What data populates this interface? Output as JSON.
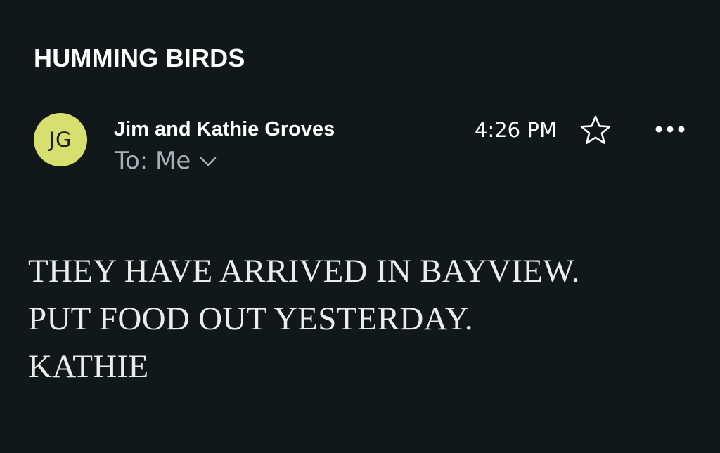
{
  "email": {
    "subject": "HUMMING BIRDS",
    "sender": {
      "initials": "JG",
      "name": "Jim and Kathie Groves",
      "avatar_color": "#d7e06f"
    },
    "recipient_label": "To: Me",
    "time": "4:26 PM",
    "body_lines": [
      "THEY HAVE ARRIVED IN BAYVIEW.",
      "PUT FOOD OUT YESTERDAY.",
      "KATHIE"
    ]
  },
  "icons": {
    "expand": "chevron-down-icon",
    "star": "star-icon",
    "more": "more-horizontal-icon"
  },
  "colors": {
    "background": "#121719",
    "text": "#ffffff",
    "muted": "#aab0b5"
  }
}
